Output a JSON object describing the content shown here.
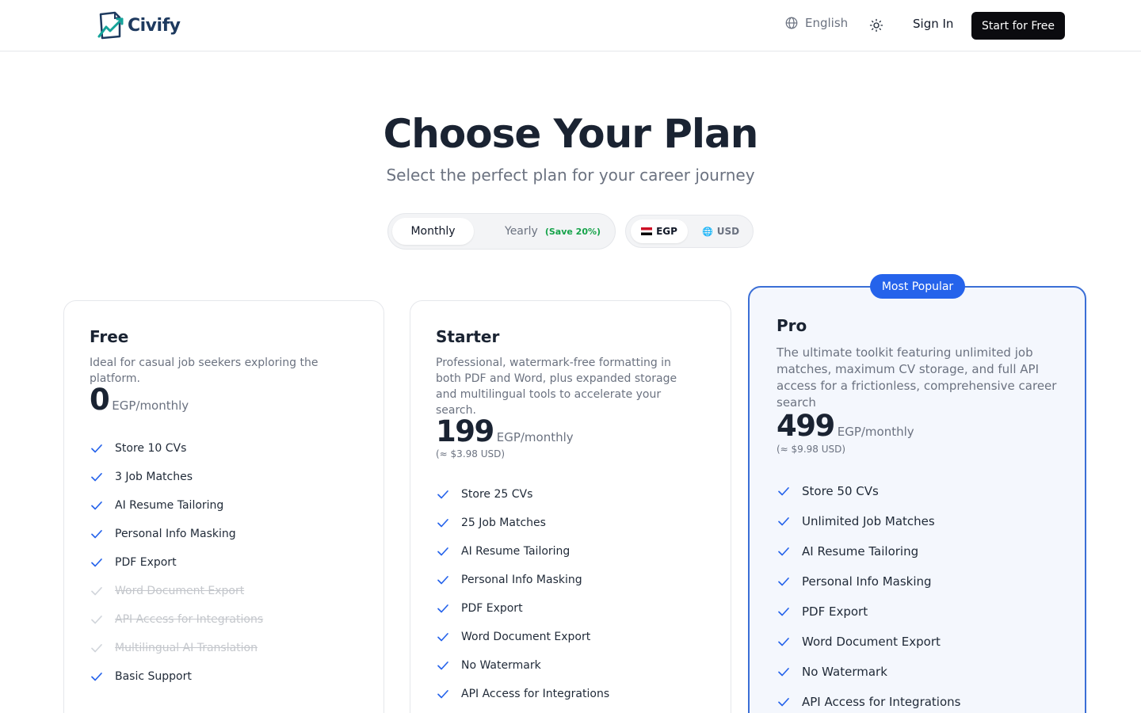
{
  "header": {
    "brand": "Civify",
    "language": "English",
    "sign_in": "Sign In",
    "cta": "Start for Free"
  },
  "hero": {
    "title": "Choose Your Plan",
    "subtitle": "Select the perfect plan for your career journey"
  },
  "billing": {
    "monthly": "Monthly",
    "yearly": "Yearly",
    "save": "(Save 20%)",
    "selected": "Monthly"
  },
  "currency": {
    "egp": "EGP",
    "usd": "USD",
    "selected": "EGP"
  },
  "colors": {
    "accent": "#2563eb",
    "check": "#2563eb",
    "save_green": "#16a34a",
    "cta_bg": "#0b0b0f"
  },
  "plans": {
    "free": {
      "name": "Free",
      "description": "Ideal for casual job seekers exploring the platform.",
      "price": "0",
      "period": "EGP/monthly",
      "features": [
        {
          "label": "Store 10 CVs",
          "included": true
        },
        {
          "label": "3 Job Matches",
          "included": true
        },
        {
          "label": "AI Resume Tailoring",
          "included": true
        },
        {
          "label": "Personal Info Masking",
          "included": true
        },
        {
          "label": "PDF Export",
          "included": true
        },
        {
          "label": "Word Document Export",
          "included": false
        },
        {
          "label": "API Access for Integrations",
          "included": false
        },
        {
          "label": "Multilingual AI Translation",
          "included": false
        },
        {
          "label": "Basic Support",
          "included": true
        }
      ]
    },
    "starter": {
      "name": "Starter",
      "description": "Professional, watermark-free formatting in both PDF and Word, plus expanded storage and multilingual tools to accelerate your search.",
      "price": "199",
      "period": "EGP/monthly",
      "usd_note": "(≈ $3.98 USD)",
      "features": [
        {
          "label": "Store 25 CVs",
          "included": true
        },
        {
          "label": "25 Job Matches",
          "included": true
        },
        {
          "label": "AI Resume Tailoring",
          "included": true
        },
        {
          "label": "Personal Info Masking",
          "included": true
        },
        {
          "label": "PDF Export",
          "included": true
        },
        {
          "label": "Word Document Export",
          "included": true
        },
        {
          "label": "No Watermark",
          "included": true
        },
        {
          "label": "API Access for Integrations",
          "included": true
        }
      ]
    },
    "pro": {
      "badge": "Most Popular",
      "name": "Pro",
      "description": "The ultimate toolkit featuring unlimited job matches, maximum CV storage, and full API access for a frictionless, comprehensive career search",
      "price": "499",
      "period": "EGP/monthly",
      "usd_note": "(≈ $9.98 USD)",
      "features": [
        {
          "label": "Store 50 CVs",
          "included": true
        },
        {
          "label": "Unlimited Job Matches",
          "included": true
        },
        {
          "label": "AI Resume Tailoring",
          "included": true
        },
        {
          "label": "Personal Info Masking",
          "included": true
        },
        {
          "label": "PDF Export",
          "included": true
        },
        {
          "label": "Word Document Export",
          "included": true
        },
        {
          "label": "No Watermark",
          "included": true
        },
        {
          "label": "API Access for Integrations",
          "included": true
        }
      ]
    }
  }
}
